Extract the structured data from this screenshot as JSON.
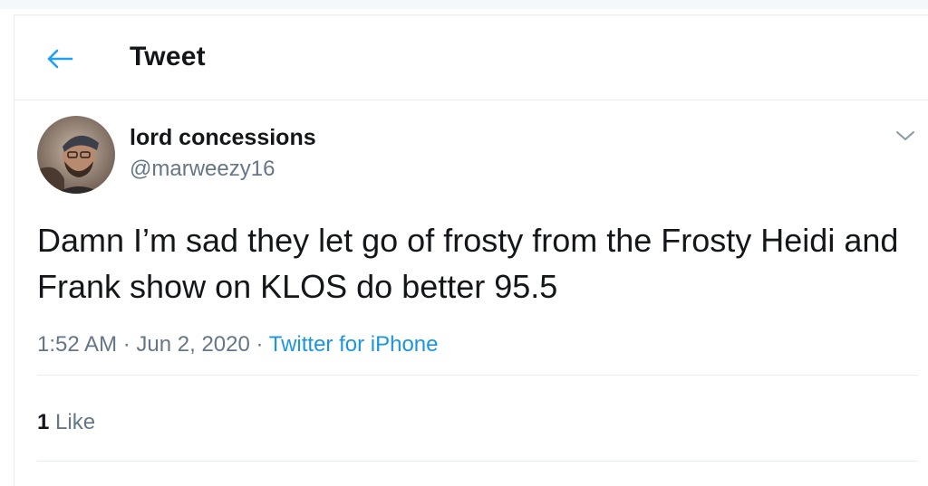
{
  "header": {
    "title": "Tweet",
    "back_icon": "arrow-left-icon"
  },
  "tweet": {
    "author": {
      "display_name": "lord concessions",
      "handle": "@marweezy16"
    },
    "text": "Damn I’m sad they let go of frosty from the Frosty Heidi and Frank show on KLOS do better 95.5",
    "time": "1:52 AM",
    "separator": "·",
    "date": "Jun 2, 2020",
    "source": "Twitter for iPhone",
    "likes": {
      "count": "1",
      "label": "Like"
    },
    "menu_icon": "chevron-down-icon"
  },
  "colors": {
    "accent": "#1b95e0",
    "text": "#14171a",
    "muted": "#657786",
    "border": "#e6ecf0"
  }
}
